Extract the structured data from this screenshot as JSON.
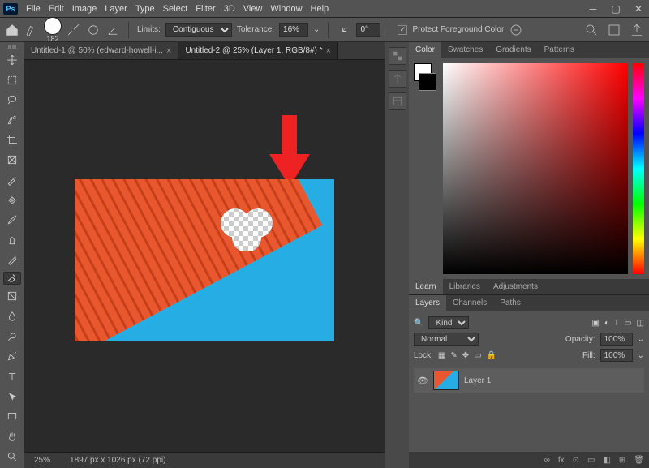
{
  "menu": {
    "items": [
      "File",
      "Edit",
      "Image",
      "Layer",
      "Type",
      "Select",
      "Filter",
      "3D",
      "View",
      "Window",
      "Help"
    ]
  },
  "options": {
    "brush_size": "182",
    "limits_label": "Limits:",
    "limits_value": "Contiguous",
    "tolerance_label": "Tolerance:",
    "tolerance_value": "16%",
    "angle_label": "Δ",
    "angle_value": "0°",
    "protect_label": "Protect Foreground Color"
  },
  "tabs": [
    {
      "label": "Untitled-1 @ 50% (edward-howell-i...",
      "active": false
    },
    {
      "label": "Untitled-2 @ 25% (Layer 1, RGB/8#) *",
      "active": true
    }
  ],
  "status": {
    "zoom": "25%",
    "dims": "1897 px x 1026 px (72 ppi)"
  },
  "colorPanel": {
    "tabs": [
      "Color",
      "Swatches",
      "Gradients",
      "Patterns"
    ],
    "active": 0
  },
  "midPanel": {
    "tabs": [
      "Learn",
      "Libraries",
      "Adjustments"
    ],
    "active": 0
  },
  "layersPanel": {
    "tabs": [
      "Layers",
      "Channels",
      "Paths"
    ],
    "active": 0,
    "kind": "Kind",
    "blend": "Normal",
    "opacity_label": "Opacity:",
    "opacity_value": "100%",
    "lock_label": "Lock:",
    "fill_label": "Fill:",
    "fill_value": "100%",
    "items": [
      {
        "name": "Layer 1"
      }
    ]
  },
  "footer_icons": [
    "∞",
    "fx",
    "⊙",
    "▭",
    "◧",
    "⊞",
    "🗑"
  ]
}
